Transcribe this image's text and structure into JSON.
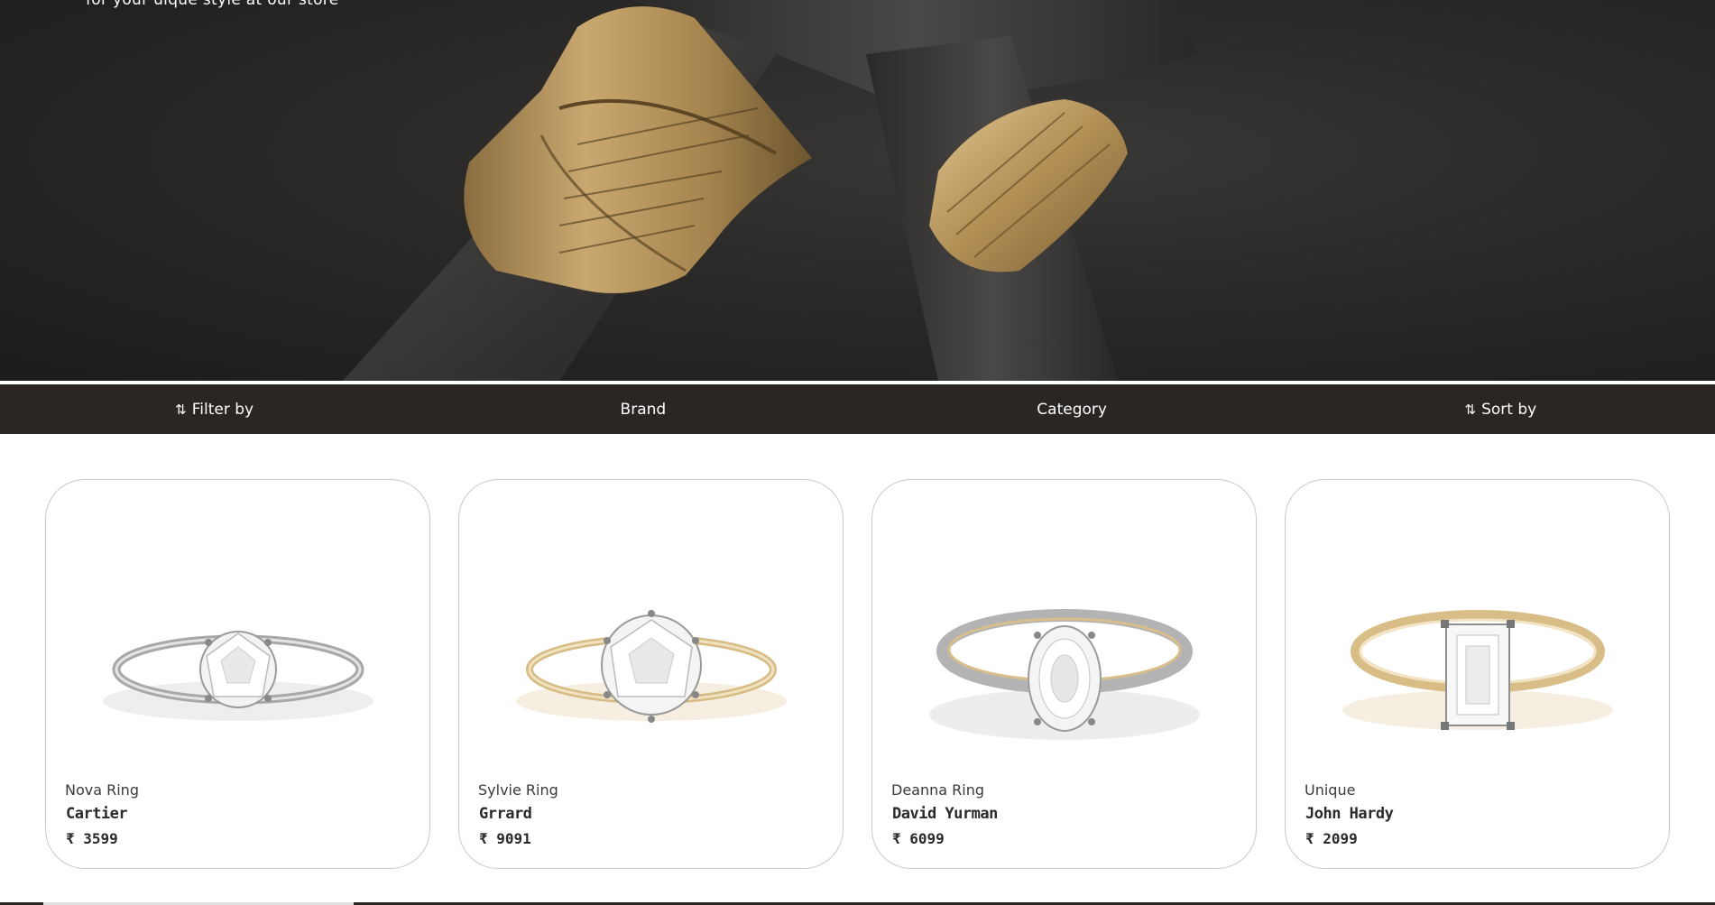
{
  "hero": {
    "tagline": "for your uique style at our store"
  },
  "filter_bar": {
    "items": [
      {
        "label": "Filter by",
        "icon": "sort-arrows-icon"
      },
      {
        "label": "Brand"
      },
      {
        "label": "Category"
      },
      {
        "label": "Sort by",
        "icon": "sort-arrows-icon"
      }
    ]
  },
  "products": [
    {
      "name": "Nova Ring",
      "brand": "Cartier",
      "price": "₹ 3599",
      "metal": "white-gold",
      "stone": "round"
    },
    {
      "name": "Sylvie Ring",
      "brand": "Grrard",
      "price": "₹ 9091",
      "metal": "yellow-gold",
      "stone": "round"
    },
    {
      "name": "Deanna Ring",
      "brand": "David Yurman",
      "price": "₹ 6099",
      "metal": "two-tone",
      "stone": "oval"
    },
    {
      "name": "Unique",
      "brand": "John Hardy",
      "price": "₹ 2099",
      "metal": "yellow-gold",
      "stone": "emerald"
    }
  ],
  "colors": {
    "bar_bg": "#2a2624",
    "white_gold": "#b8b8b8",
    "yellow_gold": "#d9c08a",
    "hero_gold": "#b99a62"
  }
}
